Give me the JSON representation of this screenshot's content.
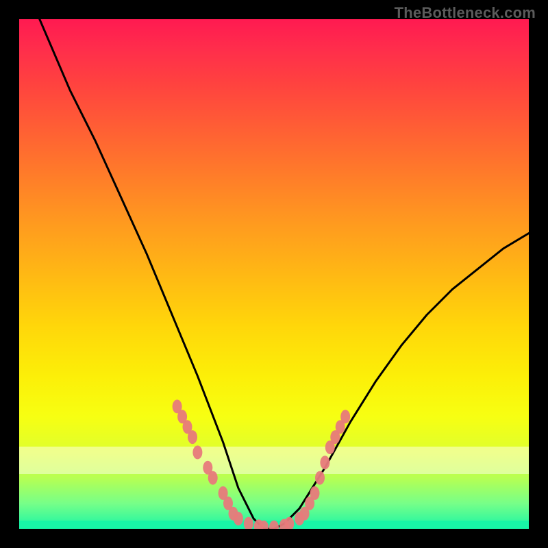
{
  "watermark": "TheBottleneck.com",
  "chart_data": {
    "type": "line",
    "title": "",
    "xlabel": "",
    "ylabel": "",
    "xlim": [
      0,
      100
    ],
    "ylim": [
      0,
      100
    ],
    "grid": false,
    "legend": false,
    "series": [
      {
        "name": "curve",
        "color": "#000000",
        "x": [
          4,
          10,
          15,
          20,
          25,
          30,
          35,
          40,
          43,
          46,
          48,
          50,
          52,
          55,
          60,
          65,
          70,
          75,
          80,
          85,
          90,
          95,
          100
        ],
        "y": [
          100,
          86,
          76,
          65,
          54,
          42,
          30,
          17,
          8,
          2,
          0,
          0,
          1,
          4,
          12,
          21,
          29,
          36,
          42,
          47,
          51,
          55,
          58
        ]
      }
    ],
    "markers": [
      {
        "name": "left-cluster",
        "color": "#e77a7b",
        "points": [
          [
            31,
            24
          ],
          [
            32,
            22
          ],
          [
            33,
            20
          ],
          [
            34,
            18
          ],
          [
            35,
            15
          ],
          [
            37,
            12
          ],
          [
            38,
            10
          ],
          [
            40,
            7
          ],
          [
            41,
            5
          ],
          [
            42,
            3
          ]
        ]
      },
      {
        "name": "bottom-cluster",
        "color": "#e77a7b",
        "points": [
          [
            43,
            2
          ],
          [
            45,
            1
          ],
          [
            47,
            0.5
          ],
          [
            48,
            0.3
          ],
          [
            50,
            0.3
          ],
          [
            52,
            0.6
          ],
          [
            53,
            1
          ],
          [
            55,
            2
          ]
        ]
      },
      {
        "name": "right-cluster",
        "color": "#e77a7b",
        "points": [
          [
            56,
            3
          ],
          [
            57,
            5
          ],
          [
            58,
            7
          ],
          [
            59,
            10
          ],
          [
            60,
            13
          ],
          [
            61,
            16
          ],
          [
            62,
            18
          ],
          [
            63,
            20
          ],
          [
            64,
            22
          ]
        ]
      }
    ],
    "background_gradient": {
      "top": "#ff1a51",
      "middle": "#ffd60a",
      "bottom": "#18f5a6"
    }
  }
}
